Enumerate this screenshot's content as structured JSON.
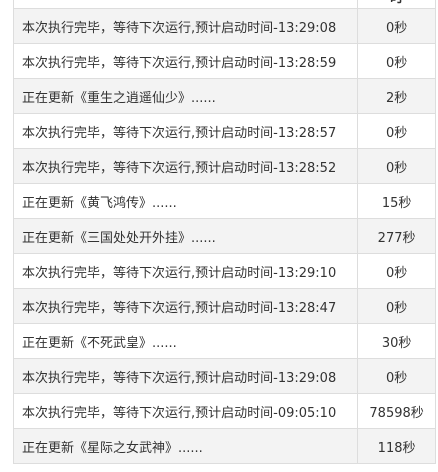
{
  "table": {
    "header": {
      "time_col": "时"
    },
    "rows": [
      {
        "message": "本次执行完毕，等待下次运行,预计启动时间-13:29:08",
        "duration": "0秒"
      },
      {
        "message": "本次执行完毕，等待下次运行,预计启动时间-13:28:59",
        "duration": "0秒"
      },
      {
        "message": "正在更新《重生之逍遥仙少》......",
        "duration": "2秒"
      },
      {
        "message": "本次执行完毕，等待下次运行,预计启动时间-13:28:57",
        "duration": "0秒"
      },
      {
        "message": "本次执行完毕，等待下次运行,预计启动时间-13:28:52",
        "duration": "0秒"
      },
      {
        "message": "正在更新《黄飞鸿传》......",
        "duration": "15秒"
      },
      {
        "message": "正在更新《三国处处开外挂》......",
        "duration": "277秒"
      },
      {
        "message": "本次执行完毕，等待下次运行,预计启动时间-13:29:10",
        "duration": "0秒"
      },
      {
        "message": "本次执行完毕，等待下次运行,预计启动时间-13:28:47",
        "duration": "0秒"
      },
      {
        "message": "正在更新《不死武皇》......",
        "duration": "30秒"
      },
      {
        "message": "本次执行完毕，等待下次运行,预计启动时间-13:29:08",
        "duration": "0秒"
      },
      {
        "message": "本次执行完毕，等待下次运行,预计启动时间-09:05:10",
        "duration": "78598秒"
      },
      {
        "message": "正在更新《星际之女武神》......",
        "duration": "118秒"
      }
    ]
  }
}
